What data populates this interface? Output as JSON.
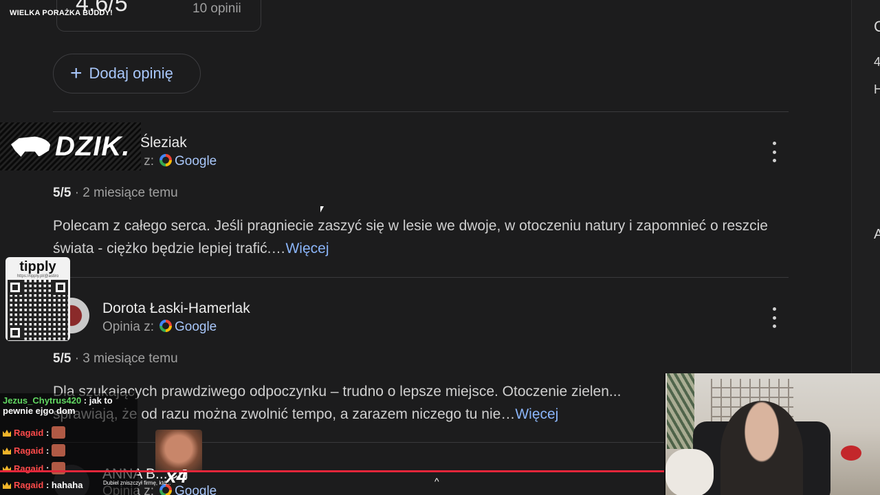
{
  "overlay": {
    "title": "WIELKA PORAŻKA BUDDY!",
    "brand": "DZIK.",
    "tipply_label": "tipply",
    "tipply_url": "https://tipply.pl/@astiro",
    "multiplier": "x4",
    "ticker": "Dubiel zniszczył firmę, któ..."
  },
  "summary": {
    "rating": "4.6/5",
    "count": "10 opinii"
  },
  "add_review": {
    "label": "Dodaj opinię"
  },
  "reviews": [
    {
      "author": "Śleziak",
      "source_prefix": "Opinia z:",
      "source": "Google",
      "score": "5/5",
      "time": "· 2 miesiące temu",
      "text": "Polecam z całego serca. Jeśli pragniecie zaszyć się w lesie we dwoje, w otoczeniu natury i zapomnieć o reszcie świata - ciężko będzie lepiej trafić.…",
      "more": "Więcej"
    },
    {
      "author": "Dorota Łaski-Hamerlak",
      "source_prefix": "Opinia z:",
      "source": "Google",
      "score": "5/5",
      "time": "· 3 miesiące temu",
      "text": "Dla szukających prawdziwego odpoczynku – trudno o lepsze miejsce. Otoczenie zielen... sprawiają, że od razu można zwolnić tempo, a zarazem niczego tu nie…",
      "more": "Więcej"
    },
    {
      "author": "ANNA B...CH",
      "source_prefix": "Opinia z:",
      "source": "Google"
    }
  ],
  "chat": [
    {
      "user": "Jezus_Chytrus420",
      "msg": ": jak to pewnie ejgo dom"
    },
    {
      "user": "Ragaid",
      "msg": ":"
    },
    {
      "user": "Ragaid",
      "msg": ":"
    },
    {
      "user": "Ragaid",
      "msg": ":"
    },
    {
      "user": "Ragaid",
      "msg": ": hahaha"
    }
  ],
  "right_panel": {
    "frag1": "G",
    "frag2": "4",
    "frag3": "H",
    "frag4": "A"
  },
  "colors": {
    "accent": "#a8c7fa",
    "link": "#8ab4f8",
    "progress": "#e3263a",
    "background": "#1c1c1d"
  }
}
